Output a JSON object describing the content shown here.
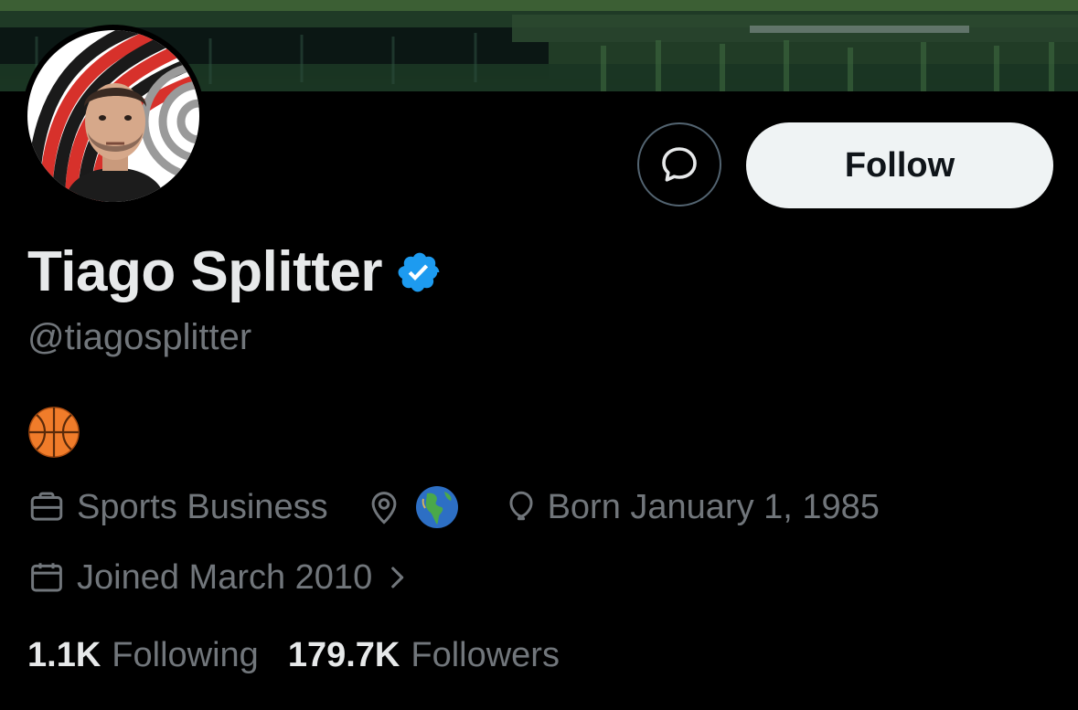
{
  "profile": {
    "display_name": "Tiago Splitter",
    "handle": "@tiagosplitter",
    "verified": true,
    "bio_icon": "basketball-icon",
    "category": "Sports Business",
    "location_icon": "globe-americas-icon",
    "birthday": "Born January 1, 1985",
    "joined": "Joined March 2010"
  },
  "actions": {
    "message_icon": "message-icon",
    "follow_label": "Follow"
  },
  "stats": {
    "following_count": "1.1K",
    "following_label": "Following",
    "followers_count": "179.7K",
    "followers_label": "Followers"
  },
  "colors": {
    "background": "#000000",
    "primary_text": "#e7e9ea",
    "secondary_text": "#71767b",
    "verified_blue": "#1d9bf0",
    "follow_button_bg": "#eff3f4",
    "avatar_red": "#d7312b"
  }
}
